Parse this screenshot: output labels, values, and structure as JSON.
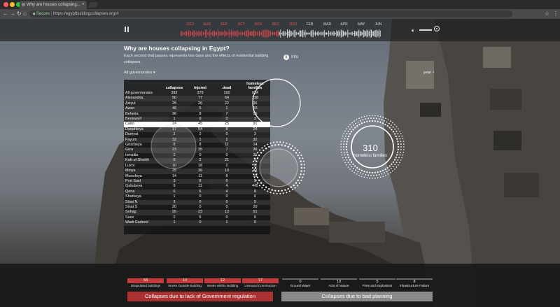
{
  "browser": {
    "tab_title": "Why are houses collapsing...",
    "secure_label": "Secure",
    "url": "https://egyptbuildingcollapses.org/#"
  },
  "player": {
    "months": [
      "2012",
      "AUG",
      "SEP",
      "OCT",
      "NOV",
      "DEC",
      "2013",
      "FEB",
      "MAR",
      "APR",
      "MAY",
      "JUN"
    ],
    "past_month_count": 7
  },
  "header": {
    "title": "Why are houses collapsing in Egypt?",
    "description": "Each second that passes represents two days and the effects of residential building collapses.",
    "info_label": "Info",
    "filter_label": "All governorates ▾",
    "year_label": "year"
  },
  "table": {
    "columns": [
      "",
      "collapses",
      "injured",
      "dead",
      "homeless families"
    ],
    "rows": [
      [
        "All governorates",
        "392",
        "379",
        "192",
        "624"
      ],
      [
        "Alexandria",
        "50",
        "77",
        "64",
        "238"
      ],
      [
        "Asiyut",
        "25",
        "26",
        "22",
        "36"
      ],
      [
        "Awan",
        "46",
        "5",
        "1",
        "50"
      ],
      [
        "Beheira",
        "36",
        "8",
        "7",
        "56"
      ],
      [
        "Benisweif",
        "1",
        "0",
        "0",
        "3"
      ],
      [
        "Cairo",
        "24",
        "45",
        "25",
        "91"
      ],
      [
        "Daqahleya",
        "17",
        "54",
        "8",
        "24"
      ],
      [
        "Dumyat",
        "2",
        "2",
        "0",
        "2"
      ],
      [
        "Fayum",
        "32",
        "1",
        "2",
        "32"
      ],
      [
        "Gharbeya",
        "8",
        "8",
        "11",
        "14"
      ],
      [
        "Giza",
        "23",
        "35",
        "7",
        "36"
      ],
      [
        "Ismailia",
        "2",
        "0",
        "0",
        "21"
      ],
      [
        "Kafr-al-Sheikh",
        "8",
        "2",
        "21",
        "8"
      ],
      [
        "Luxor",
        "10",
        "18",
        "2",
        "11"
      ],
      [
        "Minya",
        "25",
        "36",
        "10",
        "42"
      ],
      [
        "Munufeya",
        "14",
        "11",
        "8",
        "15"
      ],
      [
        "Port Said",
        "3",
        "8",
        "0",
        "5"
      ],
      [
        "Qaliubeya",
        "9",
        "11",
        "4",
        "445"
      ],
      [
        "Qena",
        "6",
        "6",
        "4",
        "8"
      ],
      [
        "Sharkeya",
        "1",
        "0",
        "0",
        "6"
      ],
      [
        "Sinai N",
        "3",
        "0",
        "0",
        "5"
      ],
      [
        "Sinai S",
        "20",
        "0",
        "0",
        "20"
      ],
      [
        "Sohag",
        "26",
        "23",
        "13",
        "51"
      ],
      [
        "Suez",
        "2",
        "6",
        "0",
        "6"
      ],
      [
        "Wadi Gadeed",
        "1",
        "0",
        "1",
        "0"
      ]
    ],
    "selected_row": 6
  },
  "circles": {
    "homeless_value": "310",
    "homeless_label": "homeless families"
  },
  "bottom": {
    "stats": [
      {
        "value": "58",
        "label": "Dilapidated buildings",
        "kind": "red"
      },
      {
        "value": "14",
        "label": "Works Outside Building",
        "kind": "red"
      },
      {
        "value": "12",
        "label": "Works Within Building",
        "kind": "red"
      },
      {
        "value": "17",
        "label": "Unsound Construction",
        "kind": "red"
      },
      {
        "value": "0",
        "label": "Ground Water",
        "kind": "gray"
      },
      {
        "value": "10",
        "label": "Acts of Nature",
        "kind": "gray"
      },
      {
        "value": "5",
        "label": "Fires and Explosions",
        "kind": "gray"
      },
      {
        "value": "8",
        "label": "Infrastructure Failure",
        "kind": "gray"
      }
    ],
    "cta_regulation": "Collapses due to lack of Government regulation",
    "cta_planning": "Collapses due to bad planning"
  },
  "colors": {
    "accent_red": "#c33a3a",
    "cta_red": "#a83232",
    "cta_gray": "#8a8a8a"
  }
}
